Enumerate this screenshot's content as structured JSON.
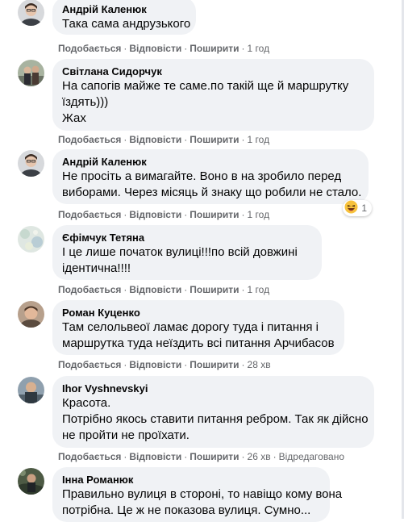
{
  "comments": [
    {
      "author": "Андрій Каленюк",
      "lines": [
        "Така сама андрузького"
      ],
      "like": "Подобається",
      "reply": "Відповісти",
      "share": "Поширити",
      "time": "1 год"
    },
    {
      "author": "Світлана Сидорчук",
      "lines": [
        "На сапогів майже те саме.по такій ще й маршрутку",
        "їздять)))",
        "Жах"
      ],
      "like": "Подобається",
      "reply": "Відповісти",
      "share": "Поширити",
      "time": "1 год"
    },
    {
      "author": "Андрій Каленюк",
      "lines": [
        "Не просіть а вимагайте. Воно в на зробило перед",
        "виборами. Через місяць й знаку що робили не стало."
      ],
      "like": "Подобається",
      "reply": "Відповісти",
      "share": "Поширити",
      "time": "1 год",
      "reaction_count": "1",
      "reaction_icon": "laughing-emoji"
    },
    {
      "author": "Єфімчук Тетяна",
      "lines": [
        "І це лише початок вулиці!!!по всій довжині",
        "ідентична!!!!"
      ],
      "like": "Подобається",
      "reply": "Відповісти",
      "share": "Поширити",
      "time": "1 год"
    },
    {
      "author": "Роман Куценко",
      "lines": [
        "Там селольвеої ламає дорогу туда і питання і",
        "маршрутка туда неїздить всі питання Арчибасов"
      ],
      "like": "Подобається",
      "reply": "Відповісти",
      "share": "Поширити",
      "time": "28 хв"
    },
    {
      "author": "Ihor Vyshnevskyi",
      "lines": [
        "Красота.",
        "Потрібно якось ставити питання ребром. Так як дійсно",
        "не пройти не проїхати."
      ],
      "like": "Подобається",
      "reply": "Відповісти",
      "share": "Поширити",
      "time": "26 хв",
      "edited": "Відредаговано"
    },
    {
      "author": "Інна Романюк",
      "lines": [
        "Правильно вулиця в стороні, то навіщо кому вона",
        "потрібна. Це ж не показова вулиця. Сумно..."
      ]
    }
  ],
  "colors": {
    "bubble": "#f0f2f5",
    "text": "#050505",
    "meta": "#65676b",
    "background": "#ffffff"
  }
}
